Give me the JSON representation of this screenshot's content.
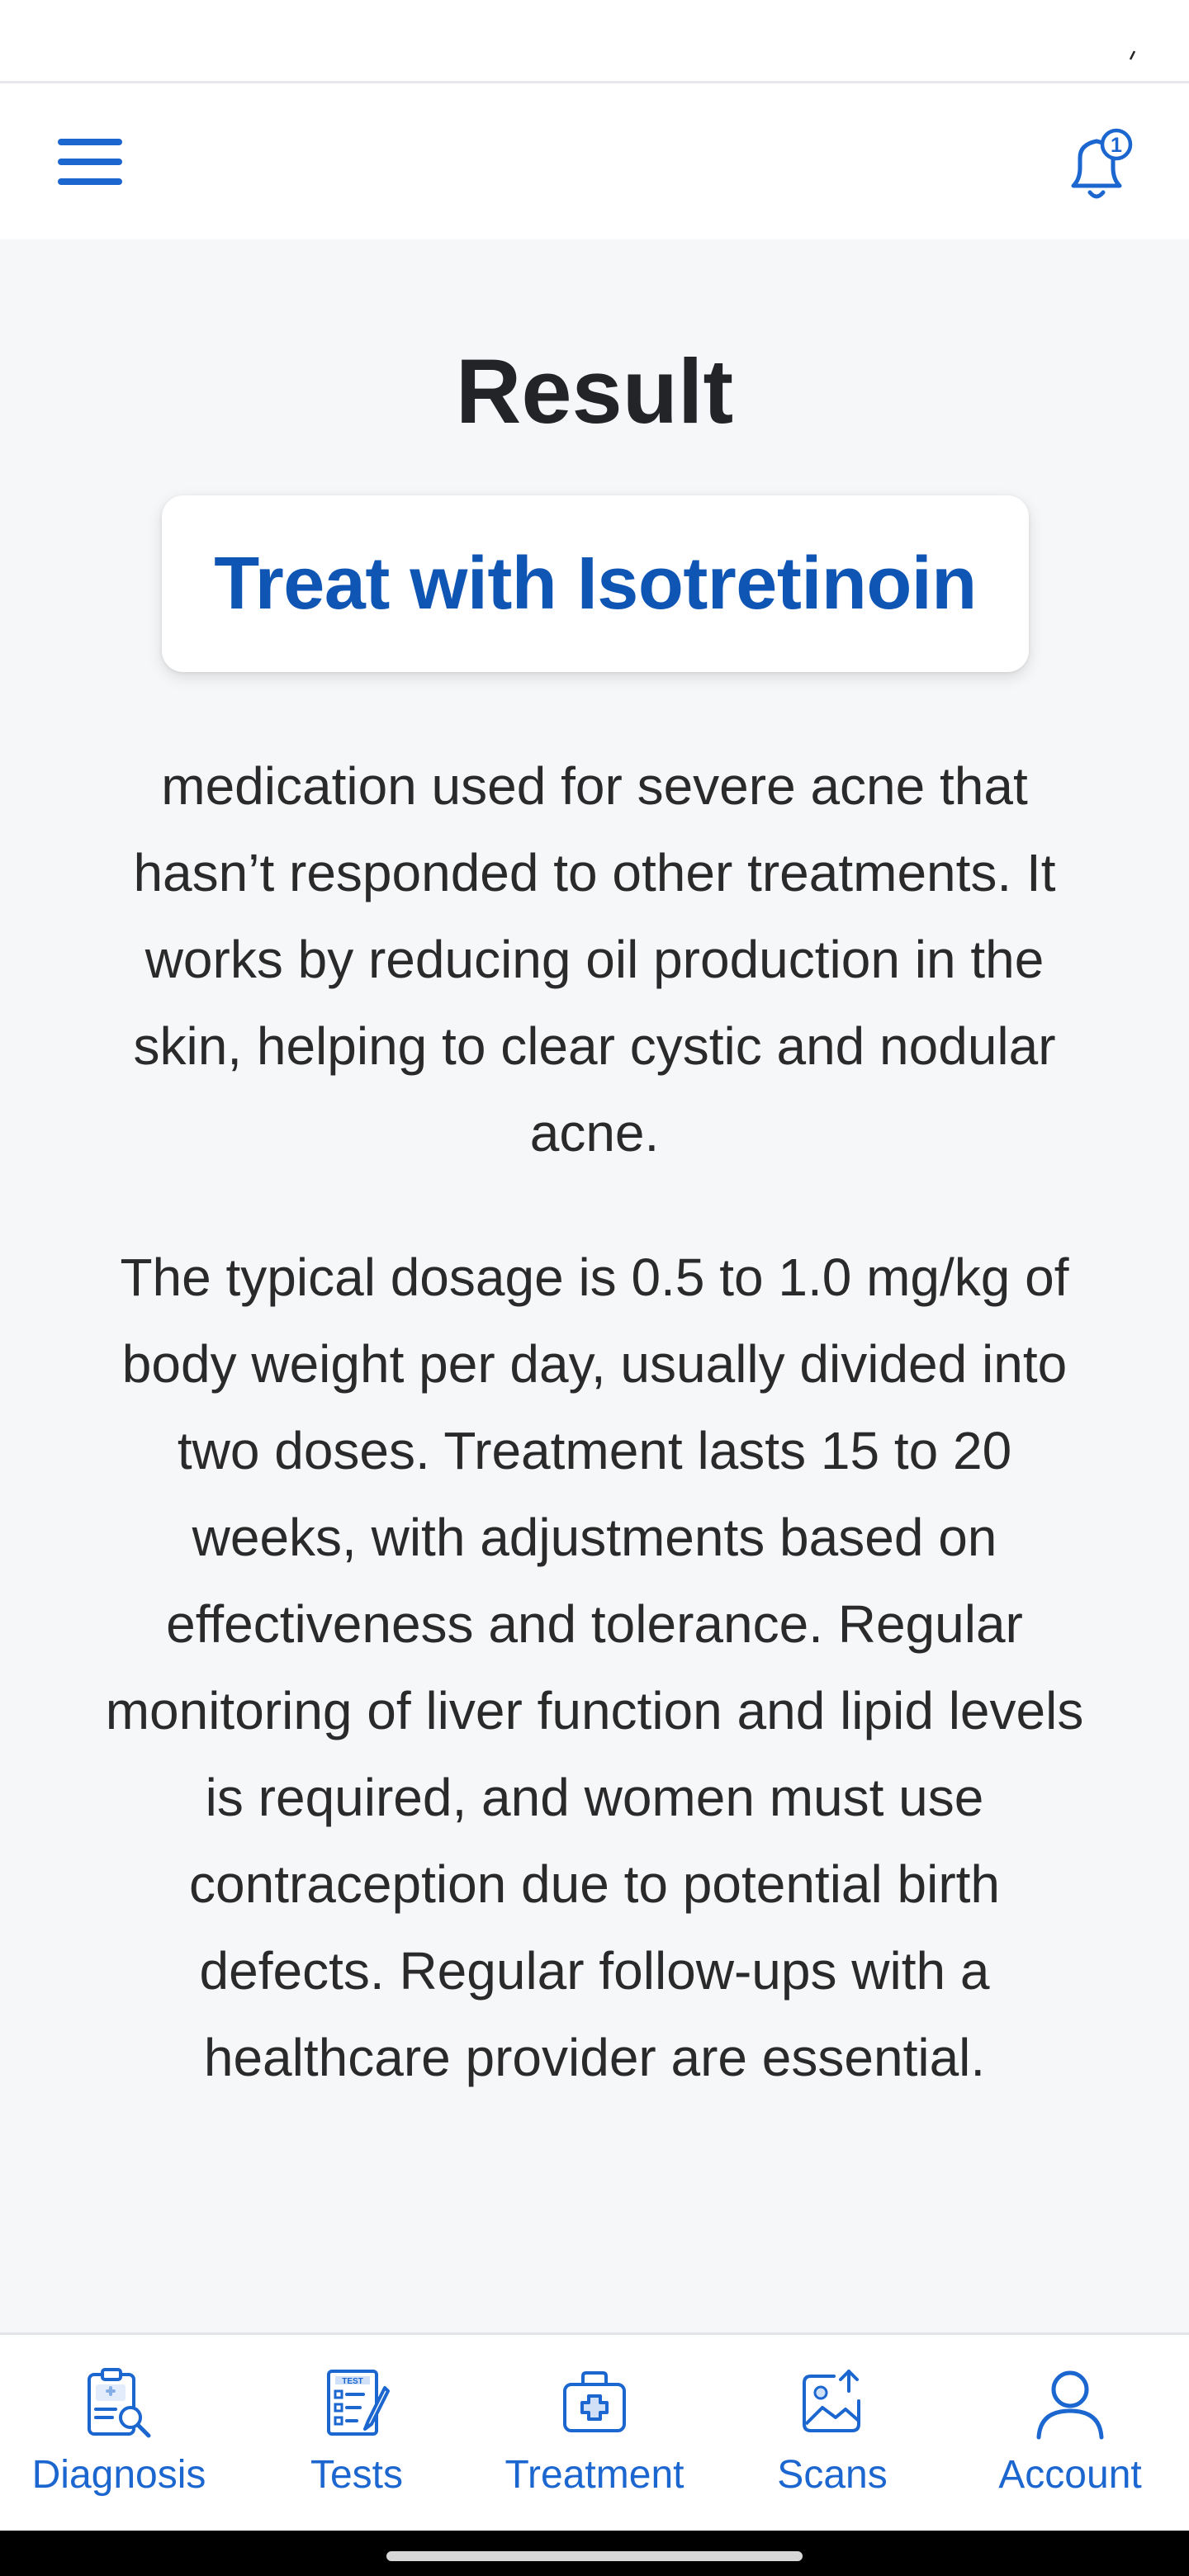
{
  "app_bar": {
    "menu_icon": "hamburger-menu-icon",
    "bell_icon": "notification-bell-icon",
    "notification_count": "1"
  },
  "main": {
    "title": "Result",
    "result": "Treat with Isotretinoin",
    "description": "medication used for severe acne that hasn’t responded to other treatments. It works by reducing oil production in the skin, helping to clear cystic and nodular acne.",
    "dosage": "The typical dosage is 0.5 to 1.0 mg/kg of body weight per day, usually divided into two doses. Treatment lasts 15 to 20 weeks, with adjustments based on effectiveness and tolerance. Regular monitoring of liver function and lipid levels is required, and women must use contraception due to potential birth defects. Regular follow-ups with a healthcare provider are essential."
  },
  "bottom_nav": {
    "items": [
      {
        "label": "Diagnosis",
        "icon": "clipboard-magnifier-icon"
      },
      {
        "label": "Tests",
        "icon": "test-checklist-icon"
      },
      {
        "label": "Treatment",
        "icon": "medical-kit-icon"
      },
      {
        "label": "Scans",
        "icon": "image-upload-icon"
      },
      {
        "label": "Account",
        "icon": "user-icon"
      }
    ]
  },
  "colors": {
    "accent": "#1b66cf",
    "result_text": "#0f55b4",
    "background": "#f6f7f9"
  }
}
